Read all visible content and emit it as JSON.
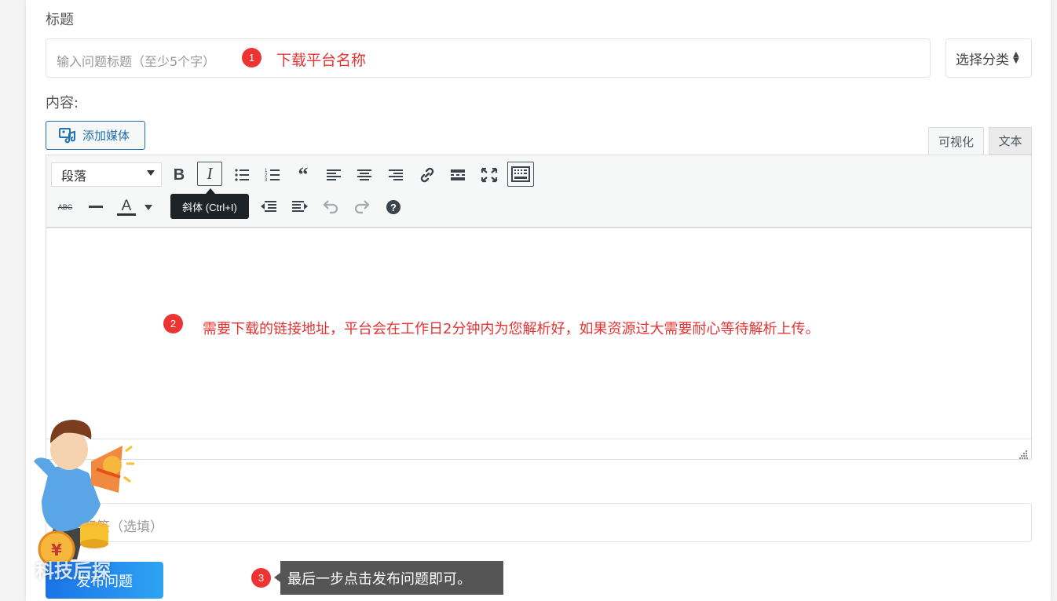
{
  "title_section": {
    "label": "标题",
    "title_placeholder": "输入问题标题（至少5个字）",
    "step1_badge": "1",
    "step1_note": "下载平台名称",
    "category_select": "选择分类"
  },
  "content_section": {
    "label": "内容:",
    "add_media_label": "添加媒体",
    "tab_visual": "可视化",
    "tab_text": "文本",
    "format_select": "段落",
    "tooltip_italic": "斜体 (Ctrl+I)",
    "step2_badge": "2",
    "step2_note": "需要下载的链接地址，平台会在工作日2分钟内为您解析好，如果资源过大需要耐心等待解析上传。"
  },
  "tags_section": {
    "tags_placeholder": "添加标签（选填）"
  },
  "footer": {
    "publish_label": "发布问题",
    "step3_badge": "3",
    "step3_note": "最后一步点击发布问题即可。",
    "watermark_text": "科技后探"
  },
  "toolbar_icons": {
    "row1": [
      "bold-icon",
      "italic-icon",
      "bullet-list-icon",
      "numbered-list-icon",
      "blockquote-icon",
      "align-left-icon",
      "align-center-icon",
      "align-right-icon",
      "link-icon",
      "read-more-icon",
      "fullscreen-icon",
      "toolbar-toggle-icon"
    ],
    "row2": [
      "strikethrough-icon",
      "horizontal-rule-icon",
      "text-color-icon",
      "paste-as-text-icon",
      "clear-formatting-icon",
      "special-character-icon",
      "outdent-icon",
      "indent-icon",
      "undo-icon",
      "redo-icon",
      "help-icon"
    ]
  },
  "colors": {
    "accent": "#2271b1",
    "annotation_red": "#e53333",
    "publish_blue": "#1a73e8"
  }
}
